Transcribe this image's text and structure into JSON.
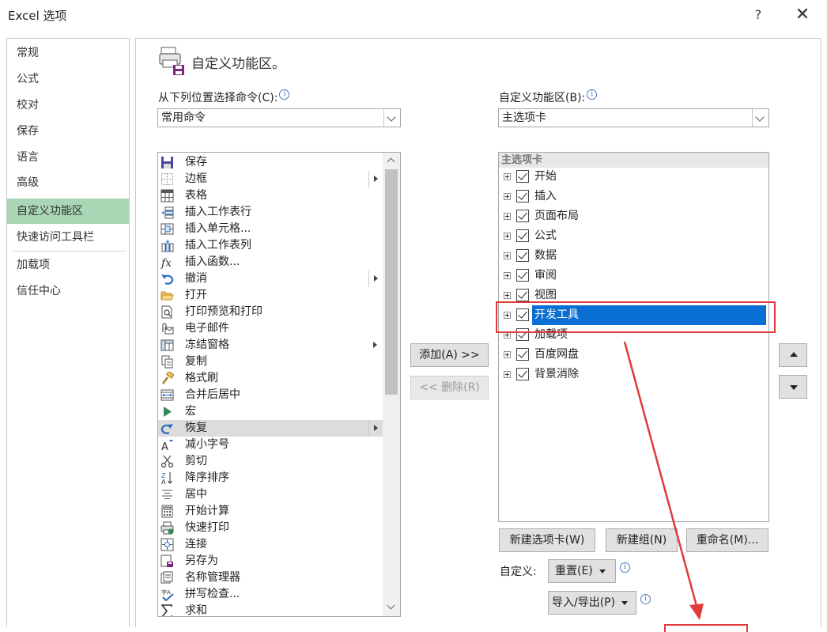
{
  "window": {
    "title": "Excel 选项",
    "help": "?",
    "close": "✕"
  },
  "nav": {
    "items": [
      "常规",
      "公式",
      "校对",
      "保存",
      "语言",
      "高级",
      "自定义功能区",
      "快速访问工具栏",
      "加载项",
      "信任中心"
    ],
    "selected": "自定义功能区"
  },
  "header": {
    "title": "自定义功能区。"
  },
  "left": {
    "label": "从下列位置选择命令(C):",
    "dropdown_value": "常用命令",
    "commands": [
      "保存",
      "边框",
      "表格",
      "插入工作表行",
      "插入单元格...",
      "插入工作表列",
      "插入函数...",
      "撤消",
      "打开",
      "打印预览和打印",
      "电子邮件",
      "冻结窗格",
      "复制",
      "格式刷",
      "合并后居中",
      "宏",
      "恢复",
      "减小字号",
      "剪切",
      "降序排序",
      "居中",
      "开始计算",
      "快速打印",
      "连接",
      "另存为",
      "名称管理器",
      "拼写检查...",
      "求和"
    ],
    "highlighted": "恢复"
  },
  "middle": {
    "add": "添加(A) >>",
    "remove": "<< 删除(R)"
  },
  "right": {
    "label": "自定义功能区(B):",
    "dropdown_value": "主选项卡",
    "tree_header": "主选项卡",
    "tabs": [
      "开始",
      "插入",
      "页面布局",
      "公式",
      "数据",
      "审阅",
      "视图",
      "开发工具",
      "加载项",
      "百度网盘",
      "背景消除"
    ],
    "selected": "开发工具"
  },
  "buttons": {
    "new_tab": "新建选项卡(W)",
    "new_group": "新建组(N)",
    "rename": "重命名(M)...",
    "customize_label": "自定义:",
    "reset": "重置(E)",
    "import_export": "导入/导出(P)"
  },
  "colors": {
    "nav_selected": "#a9d7b5",
    "tree_selected": "#0a6fd2",
    "annotation": "#e03a3a"
  }
}
